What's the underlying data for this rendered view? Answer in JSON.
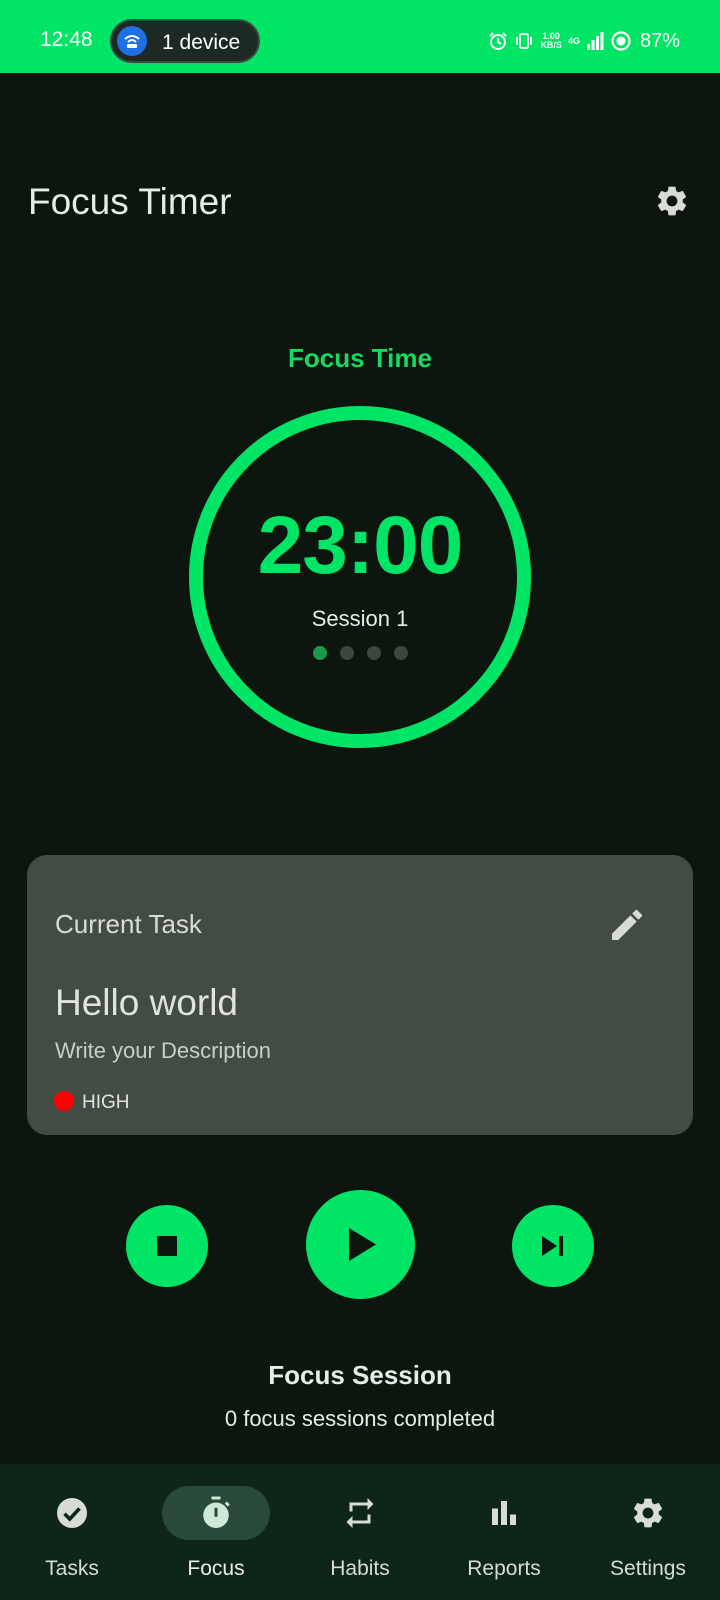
{
  "status_bar": {
    "time": "12:48",
    "cast_label": "1 device",
    "net_speed_value": "1.00",
    "net_speed_unit": "KB/S",
    "network_type": "4G",
    "battery": "87%",
    "icons": [
      "alarm-icon",
      "vibrate-icon",
      "signal-icon",
      "battery-saver-icon"
    ]
  },
  "header": {
    "title": "Focus Timer",
    "settings_icon": "gear-icon"
  },
  "timer": {
    "mode_label": "Focus Time",
    "time_remaining": "23:00",
    "session_label": "Session 1",
    "sessions_total": 4,
    "current_session": 1,
    "ring_color": "#00e565"
  },
  "task_card": {
    "section_label": "Current Task",
    "edit_icon": "pencil-icon",
    "title": "Hello world",
    "description": "Write your Description",
    "priority": "HIGH",
    "priority_color": "#ff0000"
  },
  "controls": {
    "stop_icon": "stop-icon",
    "play_icon": "play-icon",
    "skip_icon": "skip-next-icon"
  },
  "summary": {
    "heading": "Focus Session",
    "completed_text": "0 focus sessions completed"
  },
  "bottom_nav": {
    "items": [
      {
        "label": "Tasks",
        "icon": "check-circle-icon",
        "active": false
      },
      {
        "label": "Focus",
        "icon": "stopwatch-icon",
        "active": true
      },
      {
        "label": "Habits",
        "icon": "repeat-icon",
        "active": false
      },
      {
        "label": "Reports",
        "icon": "bar-chart-icon",
        "active": false
      },
      {
        "label": "Settings",
        "icon": "gear-icon",
        "active": false
      }
    ]
  },
  "colors": {
    "accent": "#00e565",
    "background": "#0d150f",
    "card": "#424c44",
    "nav_background": "#0d2619"
  }
}
